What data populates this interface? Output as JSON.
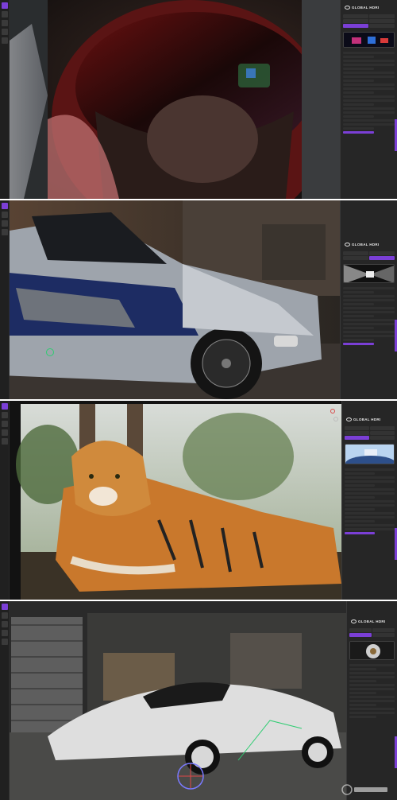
{
  "app": {
    "brand_name": "GLOBAL HDRI",
    "accent_color": "#7b3fd6",
    "panel_bg": "#262626"
  },
  "panels": [
    {
      "scene": "astronaut-helmet"
    },
    {
      "scene": "bmw-m3-gtr"
    },
    {
      "scene": "tiger"
    },
    {
      "scene": "concept-car-warehouse"
    }
  ],
  "watermark": {
    "logo_name": "gfxtra-logo"
  }
}
